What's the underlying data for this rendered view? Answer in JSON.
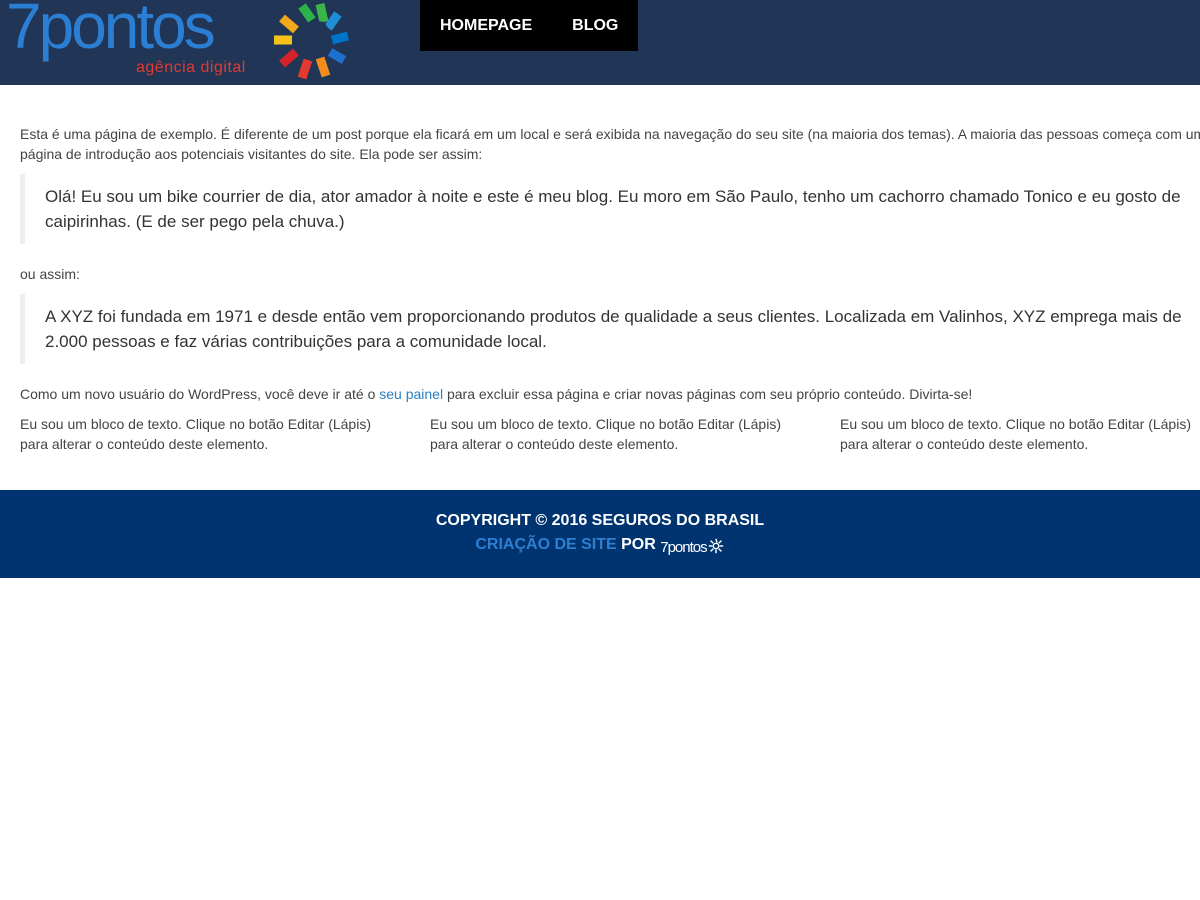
{
  "header": {
    "logo": {
      "wordmark": "7pontos",
      "tagline": "agência digital",
      "wordmark_color": "#2a7fd4",
      "tagline_color": "#e23a2e"
    },
    "nav": [
      {
        "label": "HOMEPAGE"
      },
      {
        "label": "BLOG"
      }
    ],
    "background": "#213656"
  },
  "main": {
    "intro": "Esta é uma página de exemplo. É diferente de um post porque ela ficará em um local e será exibida na navegação do seu site (na maioria dos temas). A maioria das pessoas começa com uma página de introdução aos potenciais visitantes do site. Ela pode ser assim:",
    "quote1": "Olá! Eu sou um bike courrier de dia, ator amador à noite e este é meu blog. Eu moro em São Paulo, tenho um cachorro chamado Tonico e eu gosto de caipirinhas. (E de ser pego pela chuva.)",
    "or_thus": "ou assim:",
    "quote2": "A XYZ foi fundada em 1971 e desde então vem proporcionando produtos de qualidade a seus clientes. Localizada em Valinhos, XYZ emprega mais de 2.000 pessoas e faz várias contribuições para a comunidade local.",
    "after_before_link": "Como um novo usuário do WordPress, você deve ir até o ",
    "panel_link": "seu painel",
    "after_after_link": " para excluir essa página e criar novas páginas com seu próprio conteúdo. Divirta-se!",
    "text_blocks": [
      "Eu sou um bloco de texto. Clique no botão Editar (Lápis) para alterar o conteúdo deste elemento.",
      "Eu sou um bloco de texto. Clique no botão Editar (Lápis) para alterar o conteúdo deste elemento.",
      "Eu sou um bloco de texto. Clique no botão Editar (Lápis) para alterar o conteúdo deste elemento."
    ]
  },
  "footer": {
    "copyright": "COPYRIGHT © 2016 SEGUROS DO BRASIL",
    "credit_link": "CRIAÇÃO DE SITE",
    "credit_by": " POR ",
    "credit_logo": "7pontos",
    "background": "#003471",
    "link_color": "#2f7fd0"
  }
}
